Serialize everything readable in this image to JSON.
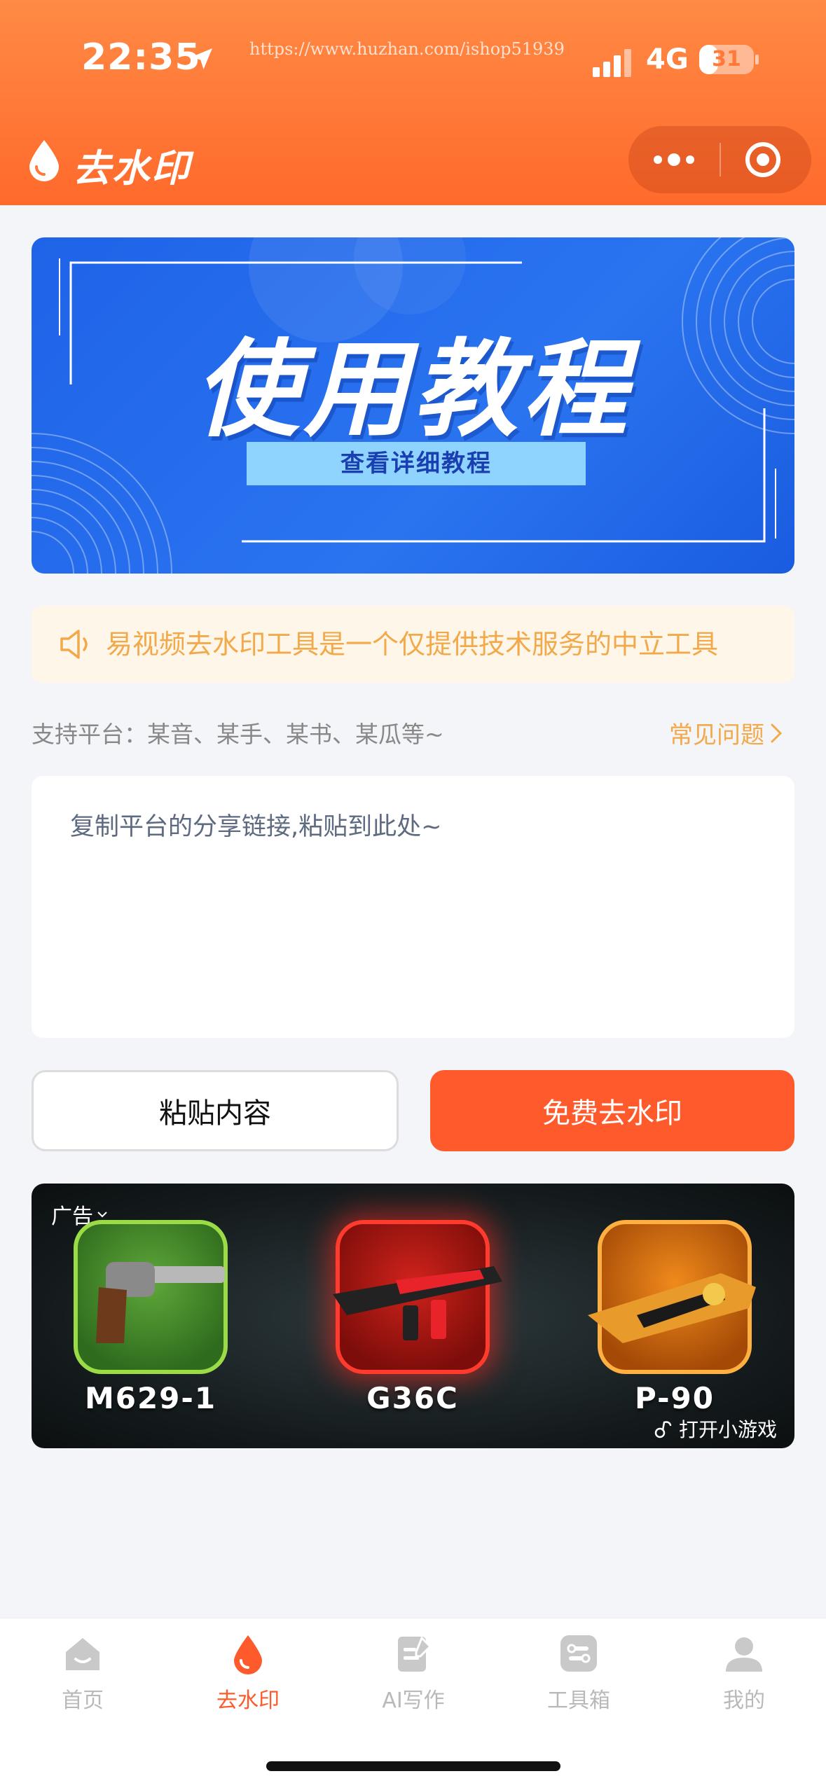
{
  "status_bar": {
    "time": "22:35",
    "watermark_url": "https://www.huzhan.com/ishop51939",
    "network": "4G",
    "battery": "31",
    "battery_level": 0.31
  },
  "header": {
    "title": "去水印"
  },
  "banner": {
    "title": "使用教程",
    "subtitle": "查看详细教程"
  },
  "notice": {
    "text": "易视频去水印工具是一个仅提供技术服务的中立工具"
  },
  "platforms": {
    "text": "支持平台：某音、某手、某书、某瓜等~",
    "faq_label": "常见问题"
  },
  "input": {
    "placeholder": "复制平台的分享链接,粘贴到此处~",
    "value": ""
  },
  "buttons": {
    "paste_label": "粘贴内容",
    "remove_label": "免费去水印"
  },
  "ad": {
    "label": "广告",
    "items": [
      {
        "name": "M629-1"
      },
      {
        "name": "G36C"
      },
      {
        "name": "P-90"
      }
    ],
    "open_label": "打开小游戏"
  },
  "tabbar": {
    "items": [
      {
        "label": "首页",
        "icon": "home-icon",
        "active": false
      },
      {
        "label": "去水印",
        "icon": "droplet-icon",
        "active": true
      },
      {
        "label": "AI写作",
        "icon": "edit-icon",
        "active": false
      },
      {
        "label": "工具箱",
        "icon": "toolbox-icon",
        "active": false
      },
      {
        "label": "我的",
        "icon": "user-icon",
        "active": false
      }
    ]
  },
  "colors": {
    "brand": "#ff5a2c",
    "header_top": "#ff8a45",
    "notice_text": "#f2a94a",
    "banner_blue": "#2a74f0"
  }
}
